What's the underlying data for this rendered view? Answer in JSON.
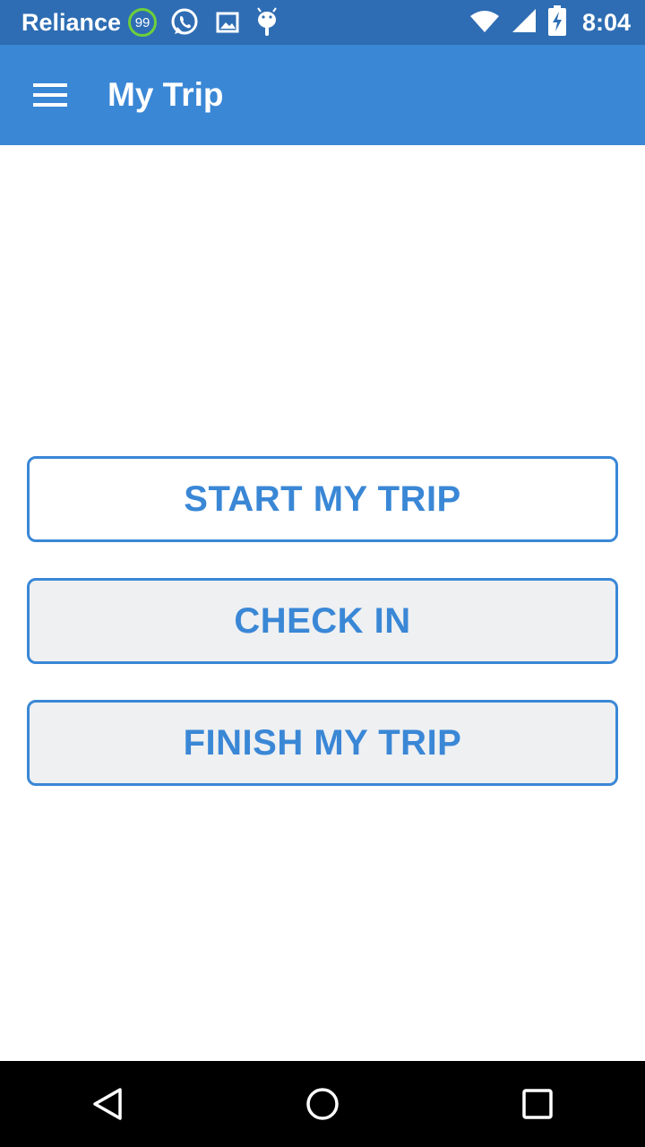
{
  "status_bar": {
    "carrier": "Reliance",
    "badge_count": "99",
    "time": "8:04",
    "icons": [
      "whatsapp-icon",
      "image-icon",
      "android-icon",
      "wifi-icon",
      "signal-icon",
      "battery-charging-icon"
    ]
  },
  "app_bar": {
    "title": "My Trip",
    "menu_icon": "hamburger-menu-icon"
  },
  "actions": {
    "start_label": "START MY TRIP",
    "checkin_label": "CHECK IN",
    "finish_label": "FINISH MY TRIP"
  },
  "nav_bar": {
    "icons": [
      "back-icon",
      "home-icon",
      "recents-icon"
    ]
  },
  "colors": {
    "status_bar": "#2e6db3",
    "app_bar": "#3a87d6",
    "accent": "#3a87d6",
    "button_fill": "#eef0f2"
  }
}
